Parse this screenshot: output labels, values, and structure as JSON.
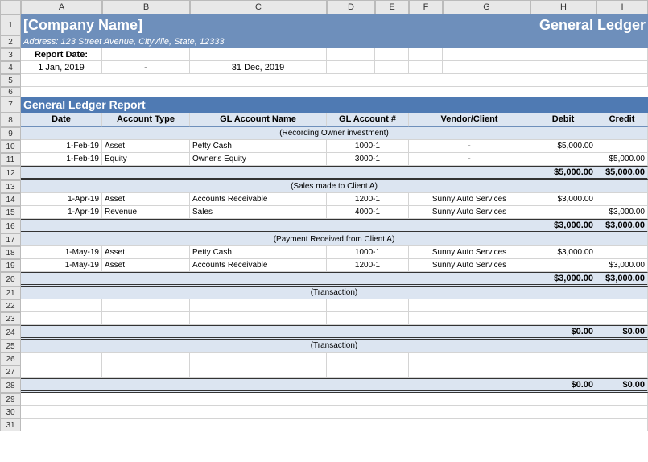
{
  "columns": [
    "A",
    "B",
    "C",
    "D",
    "E",
    "F",
    "G",
    "H",
    "I"
  ],
  "rows": [
    "1",
    "2",
    "3",
    "4",
    "5",
    "6",
    "7",
    "8",
    "9",
    "10",
    "11",
    "12",
    "13",
    "14",
    "15",
    "16",
    "17",
    "18",
    "19",
    "20",
    "21",
    "22",
    "23",
    "24",
    "25",
    "26",
    "27",
    "28",
    "29",
    "30",
    "31"
  ],
  "header": {
    "company": "[Company Name]",
    "title_right": "General Ledger",
    "address_label": "Address:",
    "address": "123 Street Avenue, Cityville, State, 12333",
    "report_date_label": "Report Date:",
    "date_from": "1 Jan, 2019",
    "date_sep": "-",
    "date_to": "31 Dec, 2019"
  },
  "section_title": "General Ledger Report",
  "col_headers": {
    "date": "Date",
    "type": "Account Type",
    "name": "GL Account Name",
    "num": "GL Account #",
    "vendor": "Vendor/Client",
    "debit": "Debit",
    "credit": "Credit"
  },
  "groups": [
    {
      "caption": "(Recording Owner investment)",
      "rows": [
        {
          "date": "1-Feb-19",
          "type": "Asset",
          "name": "Petty Cash",
          "num": "1000-1",
          "vendor": "-",
          "debit": "$5,000.00",
          "credit": ""
        },
        {
          "date": "1-Feb-19",
          "type": "Equity",
          "name": "Owner's Equity",
          "num": "3000-1",
          "vendor": "-",
          "debit": "",
          "credit": "$5,000.00"
        }
      ],
      "subtotal": {
        "debit": "$5,000.00",
        "credit": "$5,000.00"
      }
    },
    {
      "caption": "(Sales made to Client A)",
      "rows": [
        {
          "date": "1-Apr-19",
          "type": "Asset",
          "name": "Accounts Receivable",
          "num": "1200-1",
          "vendor": "Sunny Auto Services",
          "debit": "$3,000.00",
          "credit": ""
        },
        {
          "date": "1-Apr-19",
          "type": "Revenue",
          "name": "Sales",
          "num": "4000-1",
          "vendor": "Sunny Auto Services",
          "debit": "",
          "credit": "$3,000.00"
        }
      ],
      "subtotal": {
        "debit": "$3,000.00",
        "credit": "$3,000.00"
      }
    },
    {
      "caption": "(Payment Received from Client A)",
      "rows": [
        {
          "date": "1-May-19",
          "type": "Asset",
          "name": "Petty Cash",
          "num": "1000-1",
          "vendor": "Sunny Auto Services",
          "debit": "$3,000.00",
          "credit": ""
        },
        {
          "date": "1-May-19",
          "type": "Asset",
          "name": "Accounts Receivable",
          "num": "1200-1",
          "vendor": "Sunny Auto Services",
          "debit": "",
          "credit": "$3,000.00"
        }
      ],
      "subtotal": {
        "debit": "$3,000.00",
        "credit": "$3,000.00"
      }
    },
    {
      "caption": "(Transaction)",
      "rows": [
        {
          "date": "",
          "type": "",
          "name": "",
          "num": "",
          "vendor": "",
          "debit": "",
          "credit": ""
        },
        {
          "date": "",
          "type": "",
          "name": "",
          "num": "",
          "vendor": "",
          "debit": "",
          "credit": ""
        }
      ],
      "subtotal": {
        "debit": "$0.00",
        "credit": "$0.00"
      }
    },
    {
      "caption": "(Transaction)",
      "rows": [
        {
          "date": "",
          "type": "",
          "name": "",
          "num": "",
          "vendor": "",
          "debit": "",
          "credit": ""
        },
        {
          "date": "",
          "type": "",
          "name": "",
          "num": "",
          "vendor": "",
          "debit": "",
          "credit": ""
        }
      ],
      "subtotal": {
        "debit": "$0.00",
        "credit": "$0.00"
      }
    }
  ]
}
